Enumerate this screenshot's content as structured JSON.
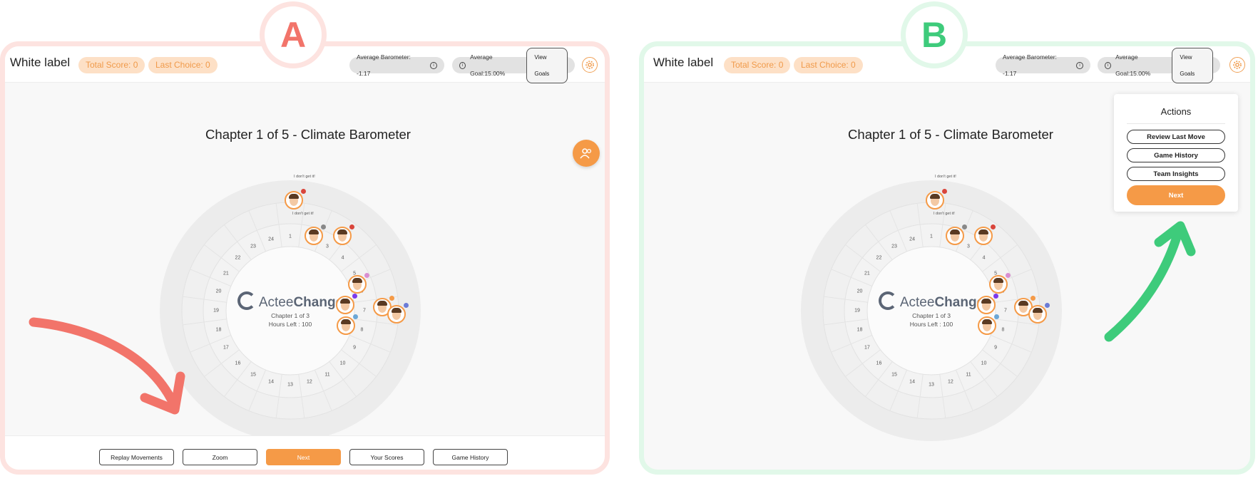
{
  "variants": [
    {
      "badge": "A",
      "accent": "#f2746a"
    },
    {
      "badge": "B",
      "accent": "#3ecb7b"
    }
  ],
  "header": {
    "brand": "White label",
    "total_score": "Total Score: 0",
    "last_choice": "Last Choice: 0",
    "average_barometer": "Average Barometer: -1.17",
    "average_goal": "Average Goal:15.00%",
    "view_goals_label": "View Goals"
  },
  "chapter_title": "Chapter 1 of 5 - Climate Barometer",
  "wheel": {
    "logo_light": "Actee",
    "logo_bold": "Change",
    "chapter_info": "Chapter 1 of 3",
    "hours_left": "Hours Left : 100",
    "numbers": [
      "1",
      "3",
      "4",
      "5",
      "6",
      "7",
      "8",
      "9",
      "10",
      "11",
      "12",
      "13",
      "14",
      "15",
      "16",
      "17",
      "18",
      "19",
      "20",
      "21",
      "22",
      "23",
      "24"
    ],
    "speech": [
      "I don't get it!",
      "I don't get it!"
    ]
  },
  "bottom_bar": {
    "buttons": [
      "Replay Movements",
      "Zoom",
      "Next",
      "Your Scores",
      "Game History"
    ]
  },
  "actions_card": {
    "title": "Actions",
    "buttons": [
      "Review Last Move",
      "Game History",
      "Team Insights"
    ],
    "next_label": "Next"
  },
  "colors": {
    "orange": "#f59a47",
    "orange_pill_bg": "#fde0c6",
    "red_accent": "#f2746a",
    "green_accent": "#3ecb7b"
  }
}
